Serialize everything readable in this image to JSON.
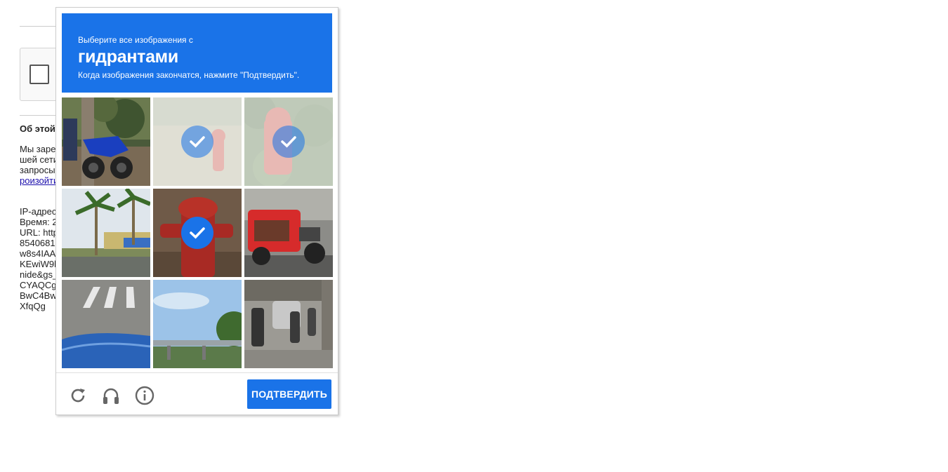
{
  "background": {
    "about_heading": "Об этой",
    "paragraph_lines": [
      "Мы заре",
      "шей сети",
      "запросы"
    ],
    "paragraph_link": "роизойти",
    "details_lines": [
      "IP-адрес",
      "Время: 2",
      "URL: http",
      "8540681",
      "w8s4IAA",
      "KEwiW9l",
      "nide&gs_",
      "CYAQCg",
      "BwC4Bw",
      "XfqQg"
    ]
  },
  "challenge": {
    "instruction_small": "Выберите все изображения с",
    "target_object": "гидрантами",
    "instruction_sub": "Когда изображения закончатся, нажмите \"Подтвердить\".",
    "tiles": [
      {
        "subject": "motorcycle-rider",
        "selected": false
      },
      {
        "subject": "fire-hydrant-grass",
        "selected": true
      },
      {
        "subject": "fire-hydrant-bushes",
        "selected": true
      },
      {
        "subject": "palm-trees-street",
        "selected": false
      },
      {
        "subject": "fire-hydrant-closeup",
        "selected": true
      },
      {
        "subject": "tricycle",
        "selected": false
      },
      {
        "subject": "crosswalk",
        "selected": false
      },
      {
        "subject": "overpass-bridge",
        "selected": false
      },
      {
        "subject": "scooters-traffic",
        "selected": false
      }
    ],
    "footer": {
      "reload_icon": "reload-icon",
      "audio_icon": "headphones-icon",
      "info_icon": "info-icon",
      "verify_label": "ПОДТВЕРДИТЬ"
    },
    "colors": {
      "accent": "#1a73e8"
    }
  }
}
